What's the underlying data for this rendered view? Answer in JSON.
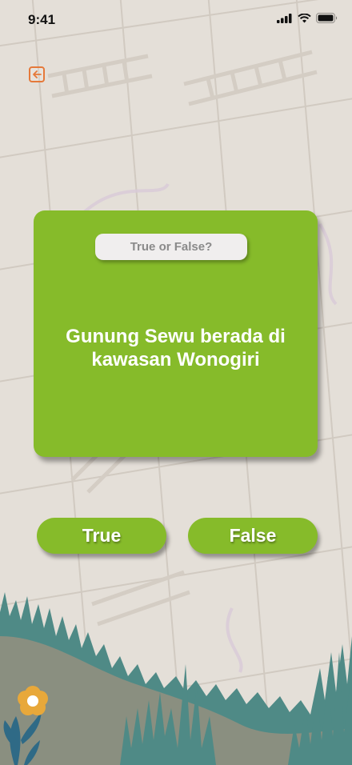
{
  "status": {
    "time": "9:41"
  },
  "card": {
    "badge": "True or False?",
    "question": "Gunung Sewu berada di kawasan Wonogiri"
  },
  "answers": {
    "true_label": "True",
    "false_label": "False"
  },
  "colors": {
    "accent": "#86bb2a",
    "back_icon": "#e5793a",
    "background": "#e4dfd8"
  },
  "icons": [
    "signal-icon",
    "wifi-icon",
    "battery-icon",
    "back-arrow-icon",
    "flower-icon"
  ]
}
